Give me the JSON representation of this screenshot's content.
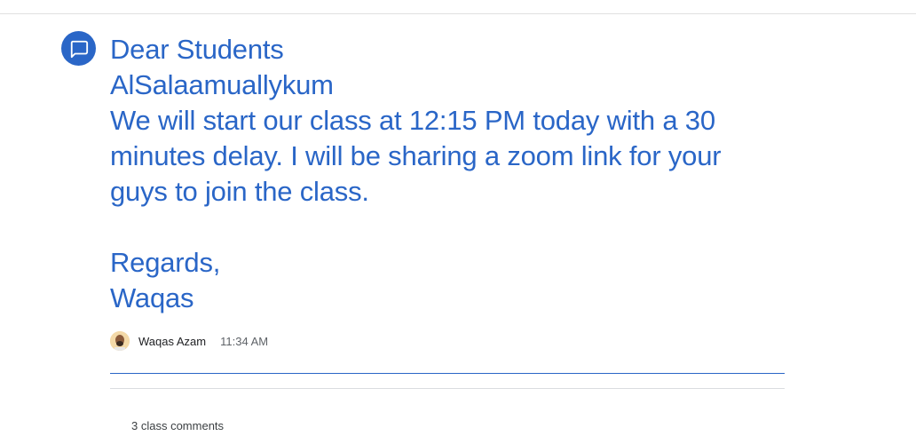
{
  "theme": {
    "accent": "#2a66c7"
  },
  "post": {
    "icon": "announcement-icon",
    "lines": [
      "Dear Students",
      "AlSalaamuallykum",
      "We will start our class at 12:15 PM today with a 30",
      "minutes delay. I will be sharing a zoom link for your",
      "guys to join the class.",
      "",
      "Regards,",
      "Waqas"
    ],
    "author": {
      "name": "Waqas Azam",
      "avatar_icon": "user-avatar"
    },
    "time": "11:34 AM"
  },
  "comments": {
    "label": "3 class comments"
  }
}
